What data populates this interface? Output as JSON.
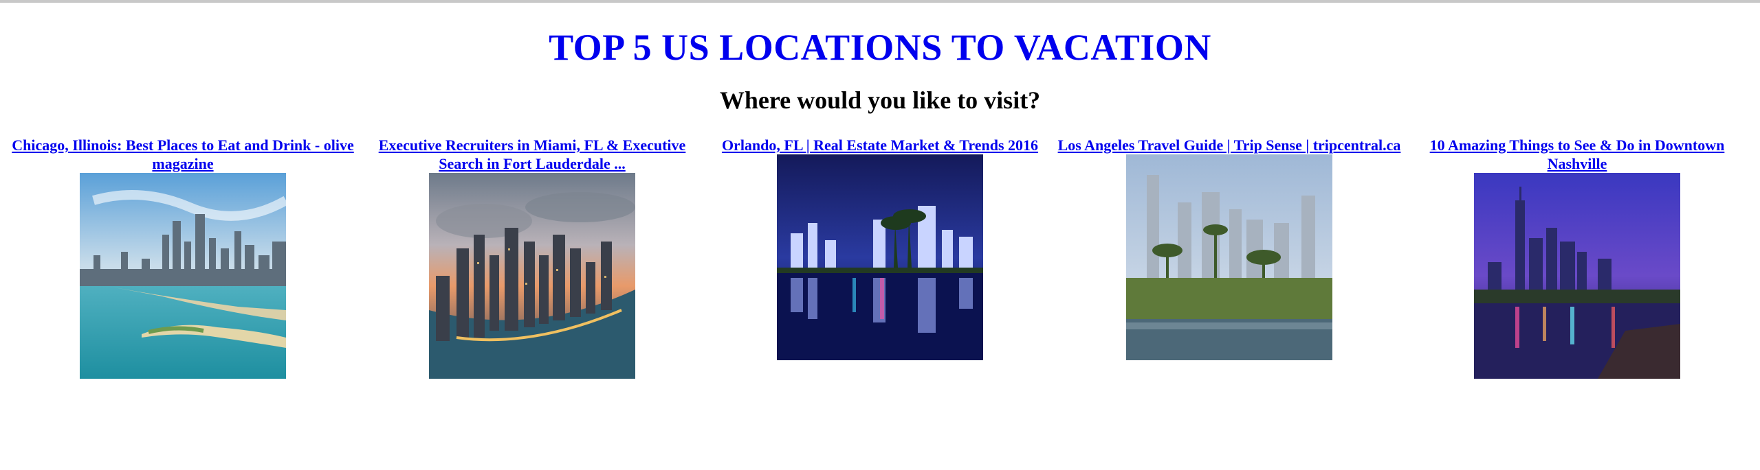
{
  "header": {
    "title": "TOP 5 US LOCATIONS TO VACATION",
    "subtitle": "Where would you like to visit?"
  },
  "cards": [
    {
      "link": "Chicago, Illinois: Best Places to Eat and Drink - olive magazine",
      "image": "chicago-skyline-lake-image"
    },
    {
      "link": "Executive Recruiters in Miami, FL & Executive Search in Fort Lauderdale ...",
      "image": "miami-skyline-sunset-image"
    },
    {
      "link": "Orlando, FL | Real Estate Market & Trends 2016",
      "image": "orlando-night-lake-image"
    },
    {
      "link": "Los Angeles Travel Guide | Trip Sense | tripcentral.ca",
      "image": "los-angeles-park-lake-image"
    },
    {
      "link": "10 Amazing Things to See & Do in Downtown Nashville",
      "image": "nashville-night-river-image"
    }
  ],
  "colors": {
    "link": "#0000ee",
    "heading": "#0000ee",
    "text": "#000000"
  }
}
